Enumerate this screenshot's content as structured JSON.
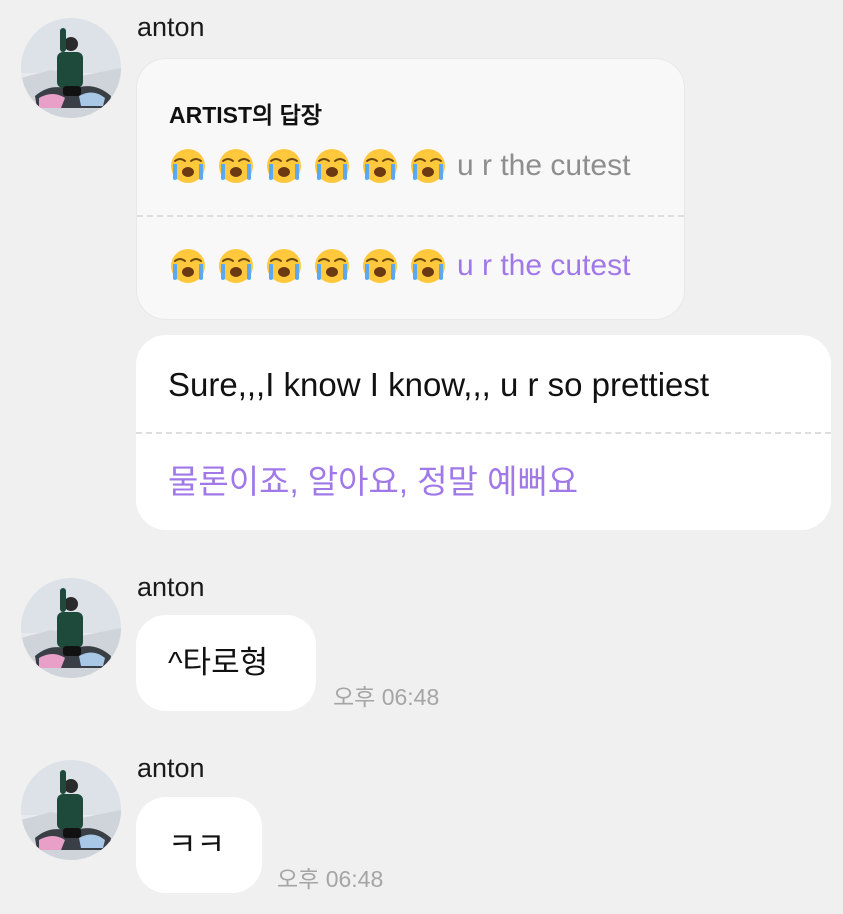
{
  "messages": [
    {
      "sender": "anton",
      "reply": {
        "heading": "ARTIST의 답장",
        "original_text": "u r the cutest",
        "translated_text": "u r the cutest",
        "emoji": "loudly-crying-face-emoji",
        "emoji_count": 6
      },
      "reply_body": {
        "original": "Sure,,,I know I know,,, u r so prettiest",
        "translated": "물론이죠, 알아요, 정말 예뻐요"
      }
    },
    {
      "sender": "anton",
      "text": "^타로형",
      "time": "오후 06:48"
    },
    {
      "sender": "anton",
      "text": "ㅋㅋ",
      "time": "오후 06:48"
    }
  ],
  "colors": {
    "background": "#f0f0f0",
    "bubble": "#ffffff",
    "reply_bubble": "#f8f8f8",
    "translation": "#a078e8",
    "muted_text": "#8e8e8e",
    "timestamp": "#a5a5a5"
  }
}
